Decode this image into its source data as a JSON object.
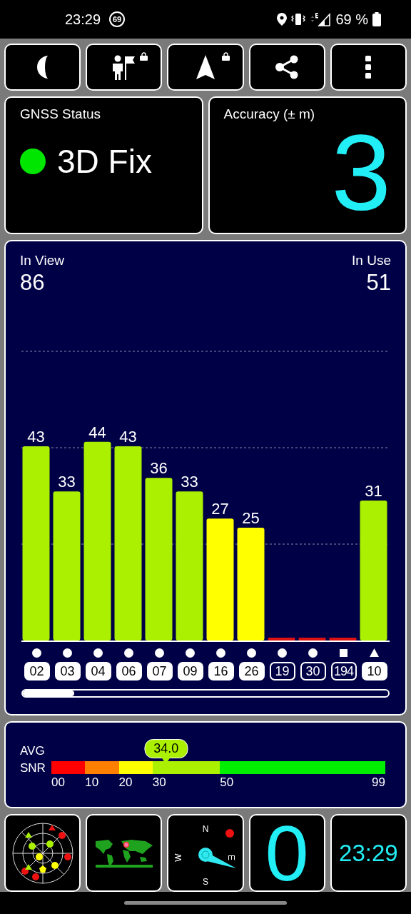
{
  "status_bar": {
    "time": "23:29",
    "badge": "69",
    "battery": "69 %"
  },
  "toolbar": [
    {
      "kind": "night",
      "locked": false
    },
    {
      "kind": "person",
      "locked": true
    },
    {
      "kind": "navigate",
      "locked": true
    },
    {
      "kind": "share",
      "locked": false
    },
    {
      "kind": "more",
      "locked": false
    }
  ],
  "gnss_status": {
    "title": "GNSS Status",
    "value": "3D Fix",
    "color": "#00e600"
  },
  "accuracy": {
    "title": "Accuracy (± m)",
    "value": "3"
  },
  "in_view": {
    "label": "In View",
    "value": "86"
  },
  "in_use": {
    "label": "In Use",
    "value": "51"
  },
  "chart_data": {
    "type": "bar",
    "categories": [
      "02",
      "03",
      "04",
      "06",
      "07",
      "09",
      "16",
      "26",
      "19",
      "30",
      "194",
      "10"
    ],
    "values": [
      43,
      33,
      44,
      43,
      36,
      33,
      27,
      25,
      0,
      0,
      0,
      31
    ],
    "value_labels": [
      "43",
      "33",
      "44",
      "43",
      "36",
      "33",
      "27",
      "25",
      null,
      null,
      null,
      "31"
    ]
  },
  "satellites": [
    {
      "kind": "circle",
      "used": true
    },
    {
      "kind": "circle",
      "used": true
    },
    {
      "kind": "circle",
      "used": true
    },
    {
      "kind": "circle",
      "used": true
    },
    {
      "kind": "circle",
      "used": true
    },
    {
      "kind": "circle",
      "used": true
    },
    {
      "kind": "circle",
      "used": true
    },
    {
      "kind": "circle",
      "used": true
    },
    {
      "kind": "circle",
      "used": false
    },
    {
      "kind": "circle",
      "used": false
    },
    {
      "kind": "square",
      "used": false
    },
    {
      "kind": "triangle",
      "used": true
    }
  ],
  "snr": {
    "label_1": "AVG",
    "label_2": "SNR",
    "value": "34.0",
    "segments": [
      {
        "from": "00",
        "color": "#ff0000"
      },
      {
        "from": "10",
        "color": "#ff8000"
      },
      {
        "from": "20",
        "color": "#ffff00"
      },
      {
        "from": "30",
        "color": "#aaf000"
      },
      {
        "from": "50",
        "color": "#00ee00"
      }
    ],
    "end": "99"
  },
  "compass": {
    "n": "N",
    "e": "E",
    "s": "S",
    "w": "W"
  },
  "speed": "0",
  "clock": "23:29"
}
